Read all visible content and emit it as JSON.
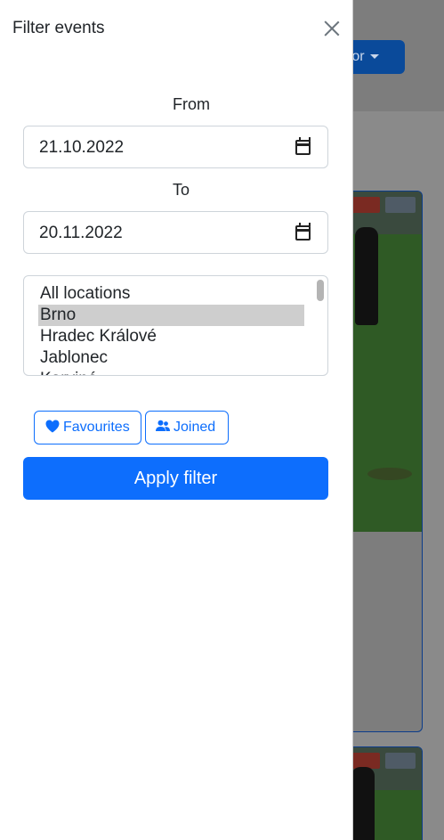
{
  "background": {
    "role_button_label": "ator"
  },
  "panel": {
    "title": "Filter events",
    "from_label": "From",
    "from_value": "21.10.2022",
    "to_label": "To",
    "to_value": "20.11.2022",
    "locations": [
      "All locations",
      "Brno",
      "Hradec Králové",
      "Jablonec",
      "Karviná"
    ],
    "selected_location": "Brno",
    "favourites_label": "Favourites",
    "joined_label": "Joined",
    "apply_label": "Apply filter"
  },
  "colors": {
    "primary": "#0d6efd",
    "selected_option": "#cecece",
    "backdrop": "#6b6b6b"
  },
  "icons": {
    "close": "close-icon",
    "calendar": "calendar-icon",
    "favourites": "heart-icon",
    "joined": "people-icon"
  }
}
